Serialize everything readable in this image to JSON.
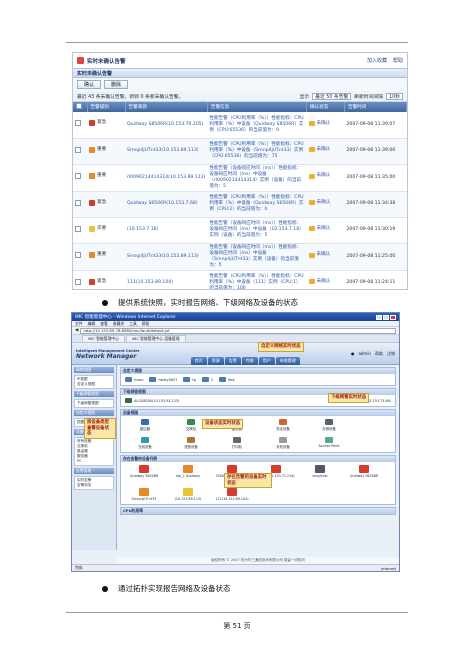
{
  "document": {
    "page_number": "第 51 页",
    "bullets": [
      "提供系统快照，实时报告网络、下级网络及设备的状态",
      "通过拓扑实现报告网络及设备状态"
    ]
  },
  "alarm_panel": {
    "title": "实时未确认告警",
    "actions": [
      "加入收藏",
      "帮助"
    ],
    "section_title": "实时未确认告警",
    "buttons": [
      "确认",
      "删除"
    ],
    "summary": "最近 43 条未确认告警，新到 0 条新未确认告警。",
    "display_label": "显示",
    "display_value": "最近 50 条告警",
    "refresh_label": "刷新时间间隔",
    "refresh_value": "10秒",
    "columns": [
      "",
      "告警级别",
      "告警来源",
      "告警信息",
      "确认状态",
      "告警时间"
    ],
    "rows": [
      {
        "level": "紧急",
        "color": "#d63b2d",
        "source": "Quidway S8506R(10.153.70.205)",
        "info": "性能告警（CPU利用率（%））性能指标：CPU利用率（%）中设备（Quidway S8506R）实例（CPU:65536）的当前值为：0",
        "status": "未确认",
        "time": "2007-09-08 11:39:07"
      },
      {
        "level": "重要",
        "color": "#e8862a",
        "source": "Srnnp4jUTnt33(10.153.89.113)",
        "info": "性能告警（CPU利用率（%））性能指标：CPU利用率（%）中设备（Srnnp4jUTnt33）实例（CPU:65536）的当前值为：75",
        "status": "未确认",
        "time": "2007-09-08 11:39:00"
      },
      {
        "level": "重要",
        "color": "#e8862a",
        "source": "rl0090214414314(10.153.89.113)",
        "info": "性能告警（设备响应时间（ms））性能指标：设备响应时间（ms）中设备（rl0090214414314）实例（设备）的当前值为：5",
        "status": "未确认",
        "time": "2007-09-08 11:35:00"
      },
      {
        "level": "紧急",
        "color": "#d63b2d",
        "source": "Quidway S6506R(10.153.7.68)",
        "info": "性能告警（CPU利用率（%））性能指标：CPU利用率（%）中设备（Quidway S6506R）实例（CPU:2）的当前值为：0",
        "status": "未确认",
        "time": "2007-09-08 11:34:38"
      },
      {
        "level": "次要",
        "color": "#e9c43a",
        "source": "(10.153.7.18)",
        "info": "性能告警（设备响应时间（ms））性能指标：设备响应时间（ms）中设备（10.153.7.18）实例（设备）的当前值为：5",
        "status": "未确认",
        "time": "2007-09-08 11:30:19"
      },
      {
        "level": "重要",
        "color": "#e8862a",
        "source": "Srnnp4jUTnt33(10.153.89.113)",
        "info": "性能告警（设备响应时间（ms））性能指标：设备响应时间（ms）中设备（Srnnp4jUTnt33）实例（设备）的当前值为：5",
        "status": "未确认",
        "time": "2007-09-08 11:25:00"
      },
      {
        "level": "紧急",
        "color": "#d63b2d",
        "source": "111(10.153.89.104)",
        "info": "性能告警（CPU利用率（%））性能指标：CPU利用率（%）中设备（111）实例（CPU:1）的当前值为：100",
        "status": "未确认",
        "time": "2007-09-08 11:24:11"
      }
    ]
  },
  "imc_window": {
    "title": "iMC 智能管理中心 - Windows Internet Explorer",
    "menu": [
      "文件",
      "编辑",
      "查看",
      "收藏夹",
      "工具",
      "帮助"
    ],
    "address": "http://10.153.89.78:8080/imc/fault/default.jsf",
    "tabs": [
      "iMC 智能管理中心",
      "iMC 智能管理中心-设备管理"
    ],
    "logo_small": "Intelligent Management Center",
    "logo_big": "Network Manager",
    "nav": [
      "首页",
      "资源",
      "告警",
      "性能",
      "用户",
      "系统管理"
    ],
    "user": "admin",
    "user_links": [
      "帮助",
      "注销"
    ],
    "left_panels": [
      {
        "title": "网络视图",
        "items": [
          "IP视图",
          "自定义视图"
        ]
      },
      {
        "title": "下级网管视图",
        "items": [
          "下级网管视图"
        ]
      },
      {
        "title": "自定义视图",
        "items": [
          "视图"
        ]
      },
      {
        "title": "设备视图",
        "items": [
          "所有设备",
          "交换机",
          "路由器",
          "服务器",
          "PC"
        ]
      },
      {
        "title": "告警管理",
        "items": [
          "实时告警",
          "告警浏览"
        ]
      }
    ],
    "sections": {
      "custom_view": "自定义视图",
      "sub_view": "下级网管视图",
      "device_view": "设备视图",
      "hosts": "存在告警的设备列表",
      "cpu": "CPU利用率"
    },
    "custom_items": [
      "hzrou",
      "hzlaty0807",
      "fg",
      "3",
      "lbsk"
    ],
    "sub_items": [
      "ALOG8000(10.153.93.123)",
      "limgnalturn(10.153.73.86)"
    ],
    "device_items": [
      "路由器",
      "交换机",
      "服务器",
      "安全设备",
      "存储设备",
      "无线设备",
      "语音设备",
      "打印机",
      "未知设备",
      "Access Point"
    ],
    "host_items": [
      "Quidway S6506R",
      "ide_2 Quidway",
      "7000(10.153.71.56)",
      "20070(10.153.71.210)",
      "snnpitest",
      "Quidway S6506R",
      "Srnnp4jUTnt33",
      "(10.153.89.113)",
      "111(10.153.89.104)"
    ],
    "callouts": [
      "自定义网络实时状态",
      "下级网管实时状态",
      "设备状态实时状态",
      "按设备类型查看设备状态",
      "存在告警的设备实时状态"
    ],
    "footer": "版权所有 © 2007 杭州华三通信技术有限公司 保留一切权利",
    "status_right": "Internet",
    "status_left": "完成"
  },
  "colors": {
    "critical": "#d63b2d",
    "major": "#e8862a",
    "minor": "#e9c43a",
    "header_blue": "#3e679f",
    "ie_blue": "#1a4296"
  }
}
